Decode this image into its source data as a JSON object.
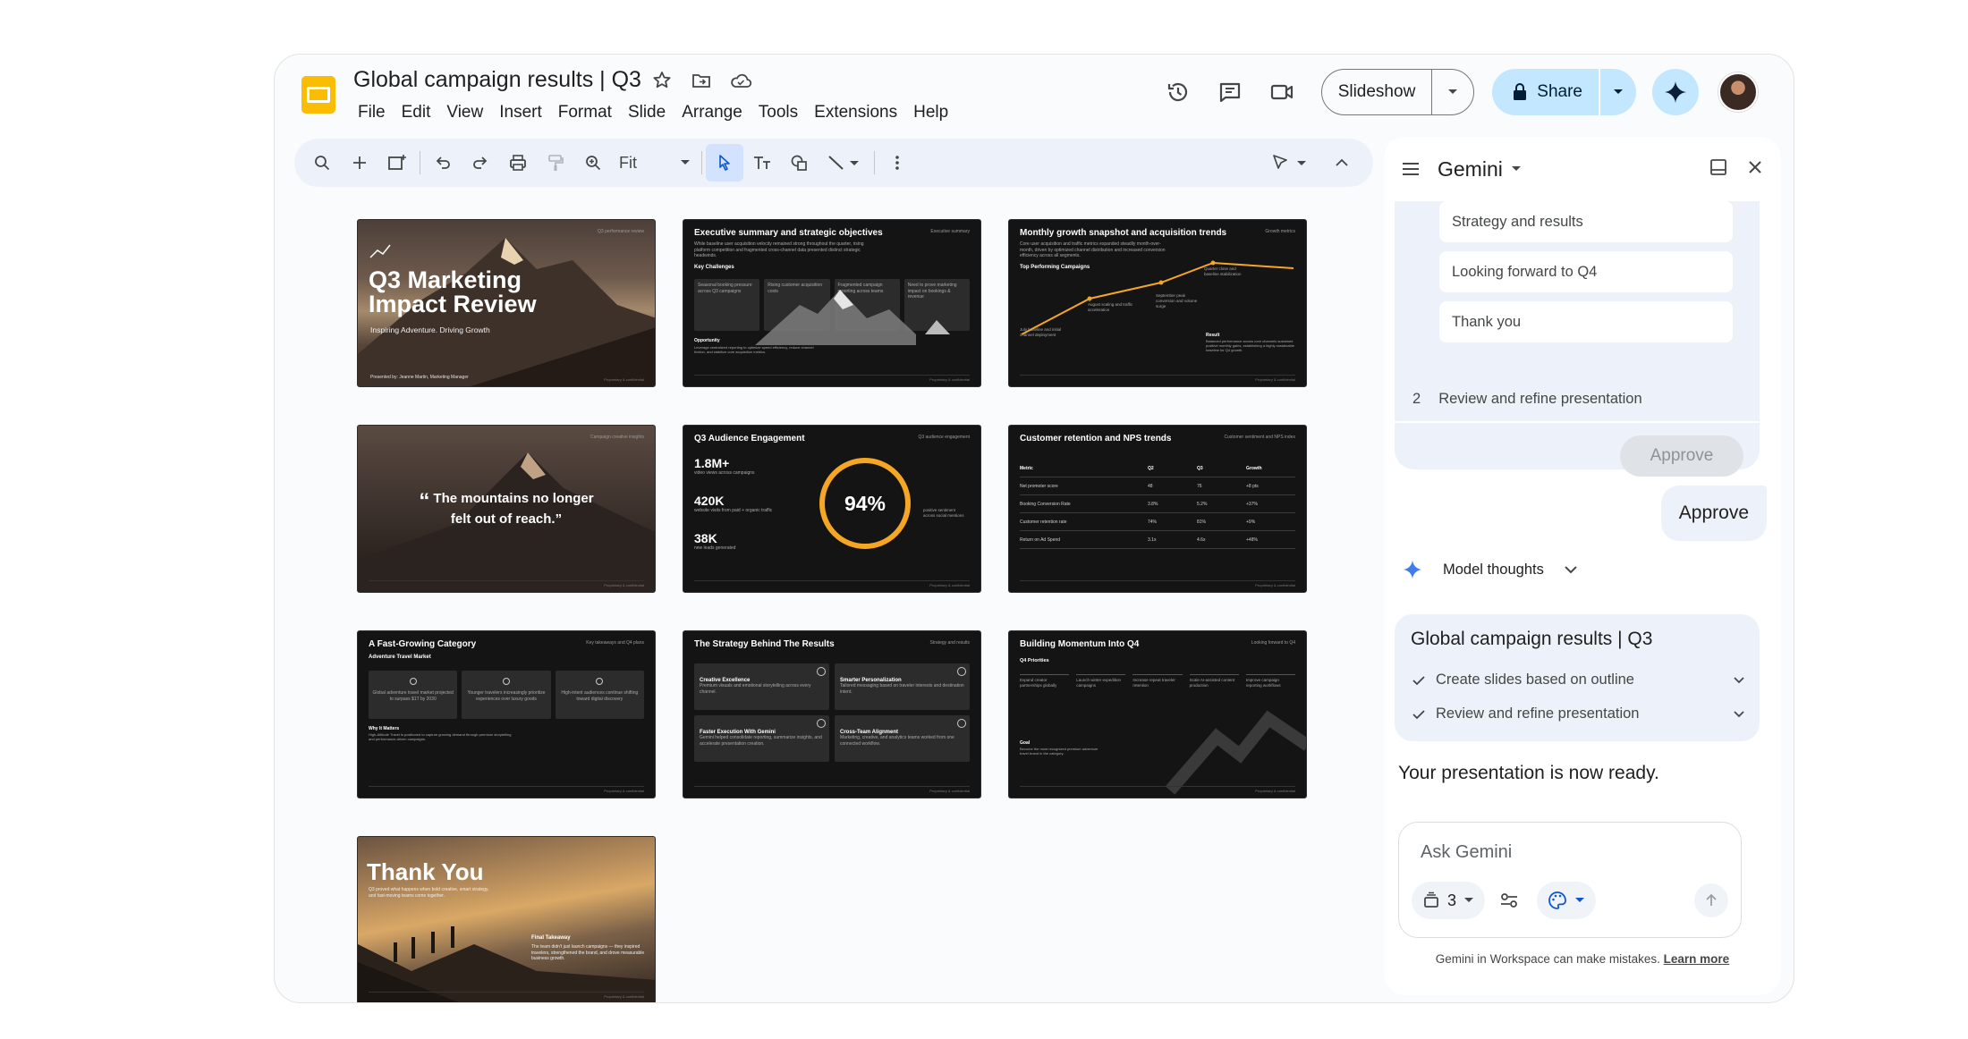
{
  "doc": {
    "title": "Global campaign results | Q3",
    "menu": [
      "File",
      "Edit",
      "View",
      "Insert",
      "Format",
      "Slide",
      "Arrange",
      "Tools",
      "Extensions",
      "Help"
    ]
  },
  "header": {
    "slideshow_label": "Slideshow",
    "share_label": "Share"
  },
  "toolbar": {
    "zoom_value": "Fit"
  },
  "slides": {
    "s1": {
      "title": "Q3 Marketing Impact Review",
      "title_line1": "Q3 Marketing",
      "title_line2": "Impact Review",
      "subtitle": "Inspiring Adventure. Driving Growth",
      "presenter": "Presented by: Jeanne Martin, Marketing Manager",
      "tag": "Q3 performance review"
    },
    "s2": {
      "title": "Executive summary and strategic objectives",
      "tag": "Executive summary",
      "intro": "While baseline user acquisition velocity remained strong throughout the quarter, rising platform competition and fragmented cross-channel data presented distinct strategic headwinds.",
      "section": "Key Challenges",
      "boxes": [
        "Seasonal booking pressure across Q3 campaigns",
        "Rising customer acquisition costs",
        "Fragmented campaign reporting across teams",
        "Need to prove marketing impact on bookings & revenue"
      ],
      "opportunity_label": "Opportunity",
      "opportunity_text": "Leverage centralized reporting to optimize spend efficiency, reduce channel friction, and stabilize core acquisition metrics."
    },
    "s3": {
      "title": "Monthly growth snapshot and acquisition trends",
      "tag": "Growth metrics",
      "intro": "Core user acquisition and traffic metrics expanded steadily month-over-month, driven by optimized channel distribution and increased conversion efficiency across all segments.",
      "section": "Top Performing Campaigns",
      "annotations": [
        "July baseline and initial channel deployment",
        "August scaling and traffic acceleration",
        "September peak conversion and volume surge",
        "Quarter close and baseline stabilization"
      ],
      "result_label": "Result",
      "result_text": "Balanced performance across core channels sustained positive monthly gains, establishing a highly sustainable baseline for Q4 growth."
    },
    "s4": {
      "quote": "The mountains no longer felt out of reach.",
      "quote_line1": "The mountains no longer",
      "quote_line2": "felt out of reach.”",
      "tag": "Campaign creative insights"
    },
    "s5": {
      "title": "Q3 Audience Engagement",
      "tag": "Q3 audience engagement",
      "m1_value": "1.8M+",
      "m1_label": "video views across campaigns",
      "m2_value": "420K",
      "m2_label": "website visits from paid + organic traffic",
      "m3_value": "38K",
      "m3_label": "new leads generated",
      "ring_value": "94%",
      "ring_label": "positive sentiment across social mentions"
    },
    "s6": {
      "title": "Customer retention and NPS trends",
      "tag": "Customer sentiment and NPS index",
      "columns": [
        "Metric",
        "Q2",
        "Q3",
        "Growth"
      ],
      "rows": [
        [
          "Net promoter score",
          "48",
          "76",
          "+8 pts"
        ],
        [
          "Booking Conversion Rate",
          "3.8%",
          "5.2%",
          "+37%"
        ],
        [
          "Customer retention rate",
          "74%",
          "81%",
          "+9%"
        ],
        [
          "Return on Ad Spend",
          "3.1x",
          "4.6x",
          "+48%"
        ]
      ]
    },
    "s7": {
      "title": "A Fast-Growing Category",
      "tag": "Key takeaways and Q4 plans",
      "section": "Adventure Travel Market",
      "boxes": [
        "Global adventure travel market projected to surpass $1T by 2030",
        "Younger travelers increasingly prioritize experiences over luxury goods",
        "High-intent audiences continue shifting toward digital discovery"
      ],
      "why_label": "Why It Matters",
      "why_text": "High-Altitude Travel is positioned to capture growing demand through premium storytelling and performance-driven campaigns."
    },
    "s8": {
      "title": "The Strategy Behind The Results",
      "tag": "Strategy and results",
      "cells": [
        {
          "title": "Creative Excellence",
          "text": "Premium visuals and emotional storytelling across every channel."
        },
        {
          "title": "Smarter Personalization",
          "text": "Tailored messaging based on traveler interests and destination intent."
        },
        {
          "title": "Faster Execution With Gemini",
          "text": "Gemini helped consolidate reporting, summarize insights, and accelerate presentation creation."
        },
        {
          "title": "Cross-Team Alignment",
          "text": "Marketing, creative, and analytics teams worked from one connected workflow."
        }
      ]
    },
    "s9": {
      "title": "Building Momentum Into Q4",
      "tag": "Looking forward to Q4",
      "section": "Q4 Priorities",
      "priorities": [
        "Expand creator partnerships globally",
        "Launch winter expedition campaigns",
        "Increase repeat traveler retention",
        "Scale AI-assisted content production",
        "Improve campaign reporting workflows"
      ],
      "goal_label": "Goal",
      "goal_text": "Become the most recognized premium adventure travel brand in the category."
    },
    "s10": {
      "title": "Thank You",
      "intro": "Q3 proved what happens when bold creative, smart strategy, and fast-moving teams come together.",
      "takeaway_label": "Final Takeaway",
      "takeaway_text": "The team didn't just launch campaigns — they inspired travelers, strengthened the brand, and drove measurable business growth."
    },
    "footer": "Proprietary & confidential"
  },
  "gemini": {
    "name": "Gemini",
    "outline_items": [
      "Strategy and results",
      "Looking forward to Q4",
      "Thank you"
    ],
    "step_number": "2",
    "step_label": "Review and refine presentation",
    "approve_disabled_label": "Approve",
    "user_message": "Approve",
    "thoughts_label": "Model thoughts",
    "summary_title": "Global campaign results | Q3",
    "summary_steps": [
      "Create slides based on outline",
      "Review and refine presentation"
    ],
    "ready_message": "Your presentation is now ready.",
    "input_placeholder": "Ask Gemini",
    "sources_count": "3",
    "disclaimer": "Gemini in Workspace can make mistakes.",
    "learn_more": "Learn more"
  },
  "colors": {
    "slides_yellow": "#fbbc04",
    "accent_blue": "#c2e7ff",
    "chart_orange": "#f5a623",
    "panel_bg": "#edf2fa"
  }
}
